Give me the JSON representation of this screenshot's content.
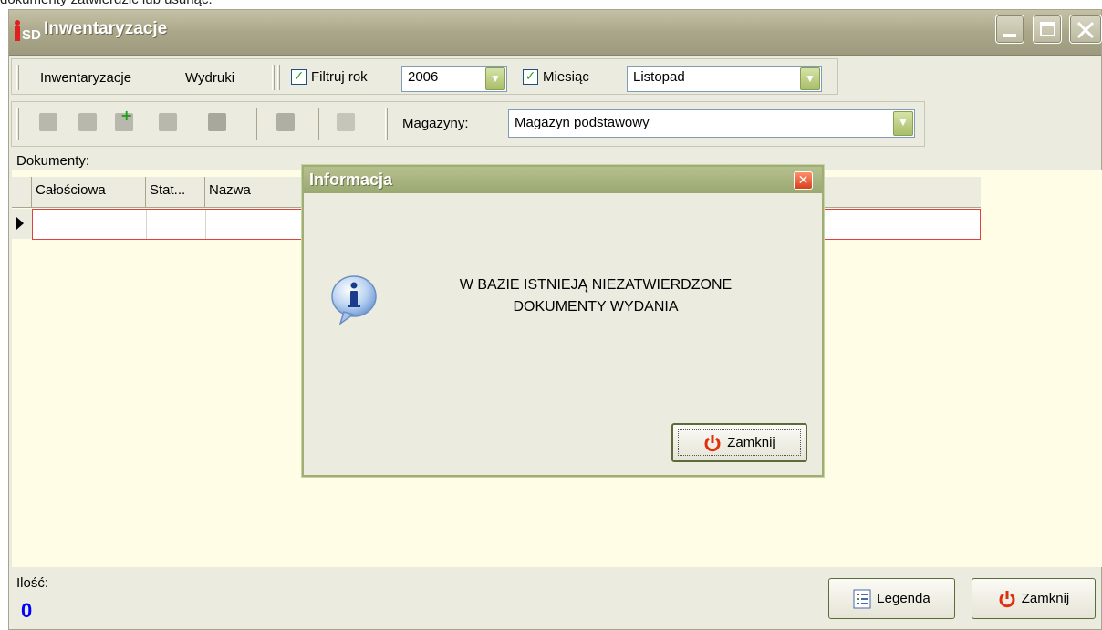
{
  "doc_text": "dokumenty zatwierdzić lub usunąć.",
  "window": {
    "title": "Inwentaryzacje",
    "logo_text": "SD"
  },
  "menu": {
    "items": [
      "Inwentaryzacje",
      "Wydruki"
    ]
  },
  "filter": {
    "year_checkbox_label": "Filtruj rok",
    "year_checked": true,
    "year_value": "2006",
    "month_checkbox_label": "Miesiąc",
    "month_checked": true,
    "month_value": "Listopad"
  },
  "warehouse": {
    "label": "Magazyny:",
    "value": "Magazyn podstawowy"
  },
  "documents": {
    "label": "Dokumenty:",
    "columns": [
      "Całościowa",
      "Stat...",
      "Nazwa"
    ]
  },
  "dialog": {
    "title": "Informacja",
    "message_line1": "W BAZIE ISTNIEJĄ NIEZATWIERDZONE",
    "message_line2": "DOKUMENTY WYDANIA",
    "close_button": "Zamknij"
  },
  "footer": {
    "count_label": "Ilość:",
    "count_value": "0",
    "legend_button": "Legenda",
    "close_button": "Zamknij"
  },
  "colors": {
    "accent_green": "#9aa872",
    "window_bg": "#ecebdf",
    "grid_bg": "#fffde6",
    "count_blue": "#0000ff",
    "power_red": "#e03010"
  }
}
